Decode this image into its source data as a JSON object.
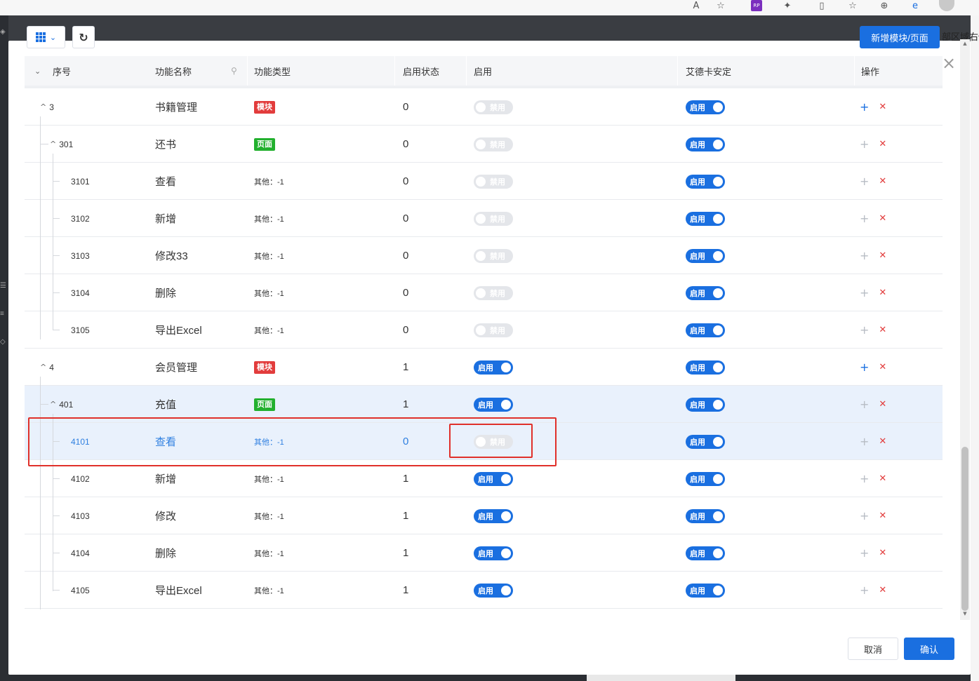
{
  "browser": {
    "icons": [
      "read-aloud-icon",
      "favorite-add-icon",
      "rp-extension-icon",
      "extensions-icon",
      "split-screen-icon",
      "favorites-icon",
      "collections-icon",
      "edge-icon",
      "profile-icon"
    ],
    "rp_label": "RP"
  },
  "background": {
    "region_label": "部区域右侧"
  },
  "toolbar": {
    "add_button_label": "新增模块/页面",
    "refresh_icon": "↻"
  },
  "table": {
    "headers": [
      "序号",
      "功能名称",
      "功能类型",
      "启用状态",
      "启用",
      "艾德卡安定",
      "操作"
    ],
    "rows": [
      {
        "id": "3",
        "level": 0,
        "expand": true,
        "name": "书籍管理",
        "type": {
          "kind": "tag",
          "text": "模块",
          "color": "#e23c3c"
        },
        "state": "0",
        "enabled": {
          "on": false,
          "label": "禁用"
        },
        "aidk": {
          "on": true,
          "label": "启用"
        },
        "add_enabled": true
      },
      {
        "id": "301",
        "level": 1,
        "expand": true,
        "name": "还书",
        "type": {
          "kind": "tag",
          "text": "页面",
          "color": "#22b02e"
        },
        "state": "0",
        "enabled": {
          "on": false,
          "label": "禁用"
        },
        "aidk": {
          "on": true,
          "label": "启用"
        },
        "add_enabled": false
      },
      {
        "id": "3101",
        "level": 2,
        "name": "查看",
        "type": {
          "kind": "text",
          "text": "其他：-1"
        },
        "state": "0",
        "enabled": {
          "on": false,
          "label": "禁用"
        },
        "aidk": {
          "on": true,
          "label": "启用"
        },
        "add_enabled": false
      },
      {
        "id": "3102",
        "level": 2,
        "name": "新增",
        "type": {
          "kind": "text",
          "text": "其他：-1"
        },
        "state": "0",
        "enabled": {
          "on": false,
          "label": "禁用"
        },
        "aidk": {
          "on": true,
          "label": "启用"
        },
        "add_enabled": false
      },
      {
        "id": "3103",
        "level": 2,
        "name": "修改33",
        "type": {
          "kind": "text",
          "text": "其他：-1"
        },
        "state": "0",
        "enabled": {
          "on": false,
          "label": "禁用"
        },
        "aidk": {
          "on": true,
          "label": "启用"
        },
        "add_enabled": false
      },
      {
        "id": "3104",
        "level": 2,
        "name": "删除",
        "type": {
          "kind": "text",
          "text": "其他：-1"
        },
        "state": "0",
        "enabled": {
          "on": false,
          "label": "禁用"
        },
        "aidk": {
          "on": true,
          "label": "启用"
        },
        "add_enabled": false
      },
      {
        "id": "3105",
        "level": 2,
        "name": "导出Excel",
        "type": {
          "kind": "text",
          "text": "其他：-1"
        },
        "state": "0",
        "enabled": {
          "on": false,
          "label": "禁用"
        },
        "aidk": {
          "on": true,
          "label": "启用"
        },
        "add_enabled": false
      },
      {
        "id": "4",
        "level": 0,
        "expand": true,
        "name": "会员管理",
        "type": {
          "kind": "tag",
          "text": "模块",
          "color": "#e23c3c"
        },
        "state": "1",
        "enabled": {
          "on": true,
          "label": "启用"
        },
        "aidk": {
          "on": true,
          "label": "启用"
        },
        "add_enabled": true
      },
      {
        "id": "401",
        "level": 1,
        "expand": true,
        "name": "充值",
        "type": {
          "kind": "tag",
          "text": "页面",
          "color": "#22b02e"
        },
        "state": "1",
        "enabled": {
          "on": true,
          "label": "启用"
        },
        "aidk": {
          "on": true,
          "label": "启用"
        },
        "add_enabled": false,
        "highlight": true
      },
      {
        "id": "4101",
        "level": 2,
        "name": "查看",
        "type": {
          "kind": "text",
          "text": "其他：-1"
        },
        "state": "0",
        "enabled": {
          "on": false,
          "label": "禁用"
        },
        "aidk": {
          "on": true,
          "label": "启用"
        },
        "add_enabled": false,
        "selected": true
      },
      {
        "id": "4102",
        "level": 2,
        "name": "新增",
        "type": {
          "kind": "text",
          "text": "其他：-1"
        },
        "state": "1",
        "enabled": {
          "on": true,
          "label": "启用"
        },
        "aidk": {
          "on": true,
          "label": "启用"
        },
        "add_enabled": false
      },
      {
        "id": "4103",
        "level": 2,
        "name": "修改",
        "type": {
          "kind": "text",
          "text": "其他：-1"
        },
        "state": "1",
        "enabled": {
          "on": true,
          "label": "启用"
        },
        "aidk": {
          "on": true,
          "label": "启用"
        },
        "add_enabled": false
      },
      {
        "id": "4104",
        "level": 2,
        "name": "删除",
        "type": {
          "kind": "text",
          "text": "其他：-1"
        },
        "state": "1",
        "enabled": {
          "on": true,
          "label": "启用"
        },
        "aidk": {
          "on": true,
          "label": "启用"
        },
        "add_enabled": false
      },
      {
        "id": "4105",
        "level": 2,
        "name": "导出Excel",
        "type": {
          "kind": "text",
          "text": "其他：-1"
        },
        "state": "1",
        "enabled": {
          "on": true,
          "label": "启用"
        },
        "aidk": {
          "on": true,
          "label": "启用"
        },
        "add_enabled": false
      }
    ]
  },
  "footer": {
    "cancel_label": "取消",
    "ok_label": "确认"
  },
  "colors": {
    "primary": "#1a6fe0",
    "danger": "#e23c3c",
    "success": "#22b02e",
    "highlight_border": "#e0302a"
  }
}
